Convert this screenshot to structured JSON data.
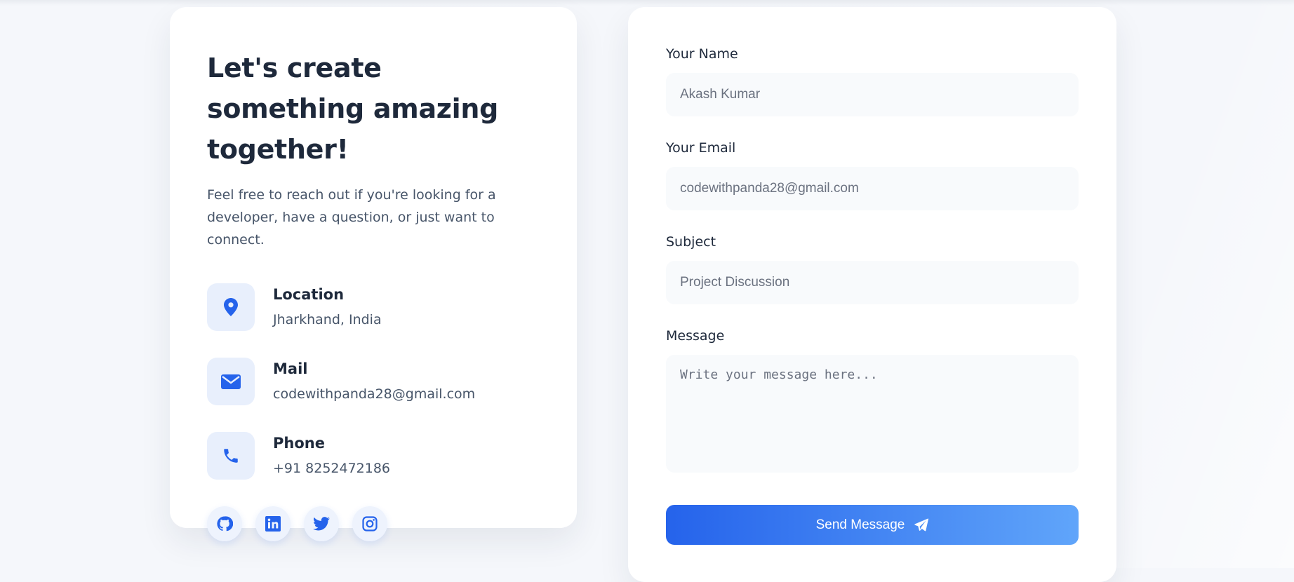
{
  "info": {
    "title": "Let's create something amazing together!",
    "description": "Feel free to reach out if you're looking for a developer, have a question, or just want to connect.",
    "contacts": [
      {
        "icon": "location-pin-icon",
        "label": "Location",
        "value": "Jharkhand, India"
      },
      {
        "icon": "mail-icon",
        "label": "Mail",
        "value": "codewithpanda28@gmail.com"
      },
      {
        "icon": "phone-icon",
        "label": "Phone",
        "value": "+91 8252472186"
      }
    ],
    "socials": [
      "github-icon",
      "linkedin-icon",
      "twitter-icon",
      "instagram-icon"
    ]
  },
  "form": {
    "name_label": "Your Name",
    "name_placeholder": "Akash Kumar",
    "email_label": "Your Email",
    "email_placeholder": "codewithpanda28@gmail.com",
    "subject_label": "Subject",
    "subject_placeholder": "Project Discussion",
    "message_label": "Message",
    "message_placeholder": "Write your message here...",
    "submit_label": "Send Message",
    "submit_icon": "paper-plane-icon"
  },
  "colors": {
    "accent": "#2563eb",
    "accent_light": "#60a5fa",
    "icon_bg": "#e8effc",
    "page_bg": "#f5f7fb"
  }
}
